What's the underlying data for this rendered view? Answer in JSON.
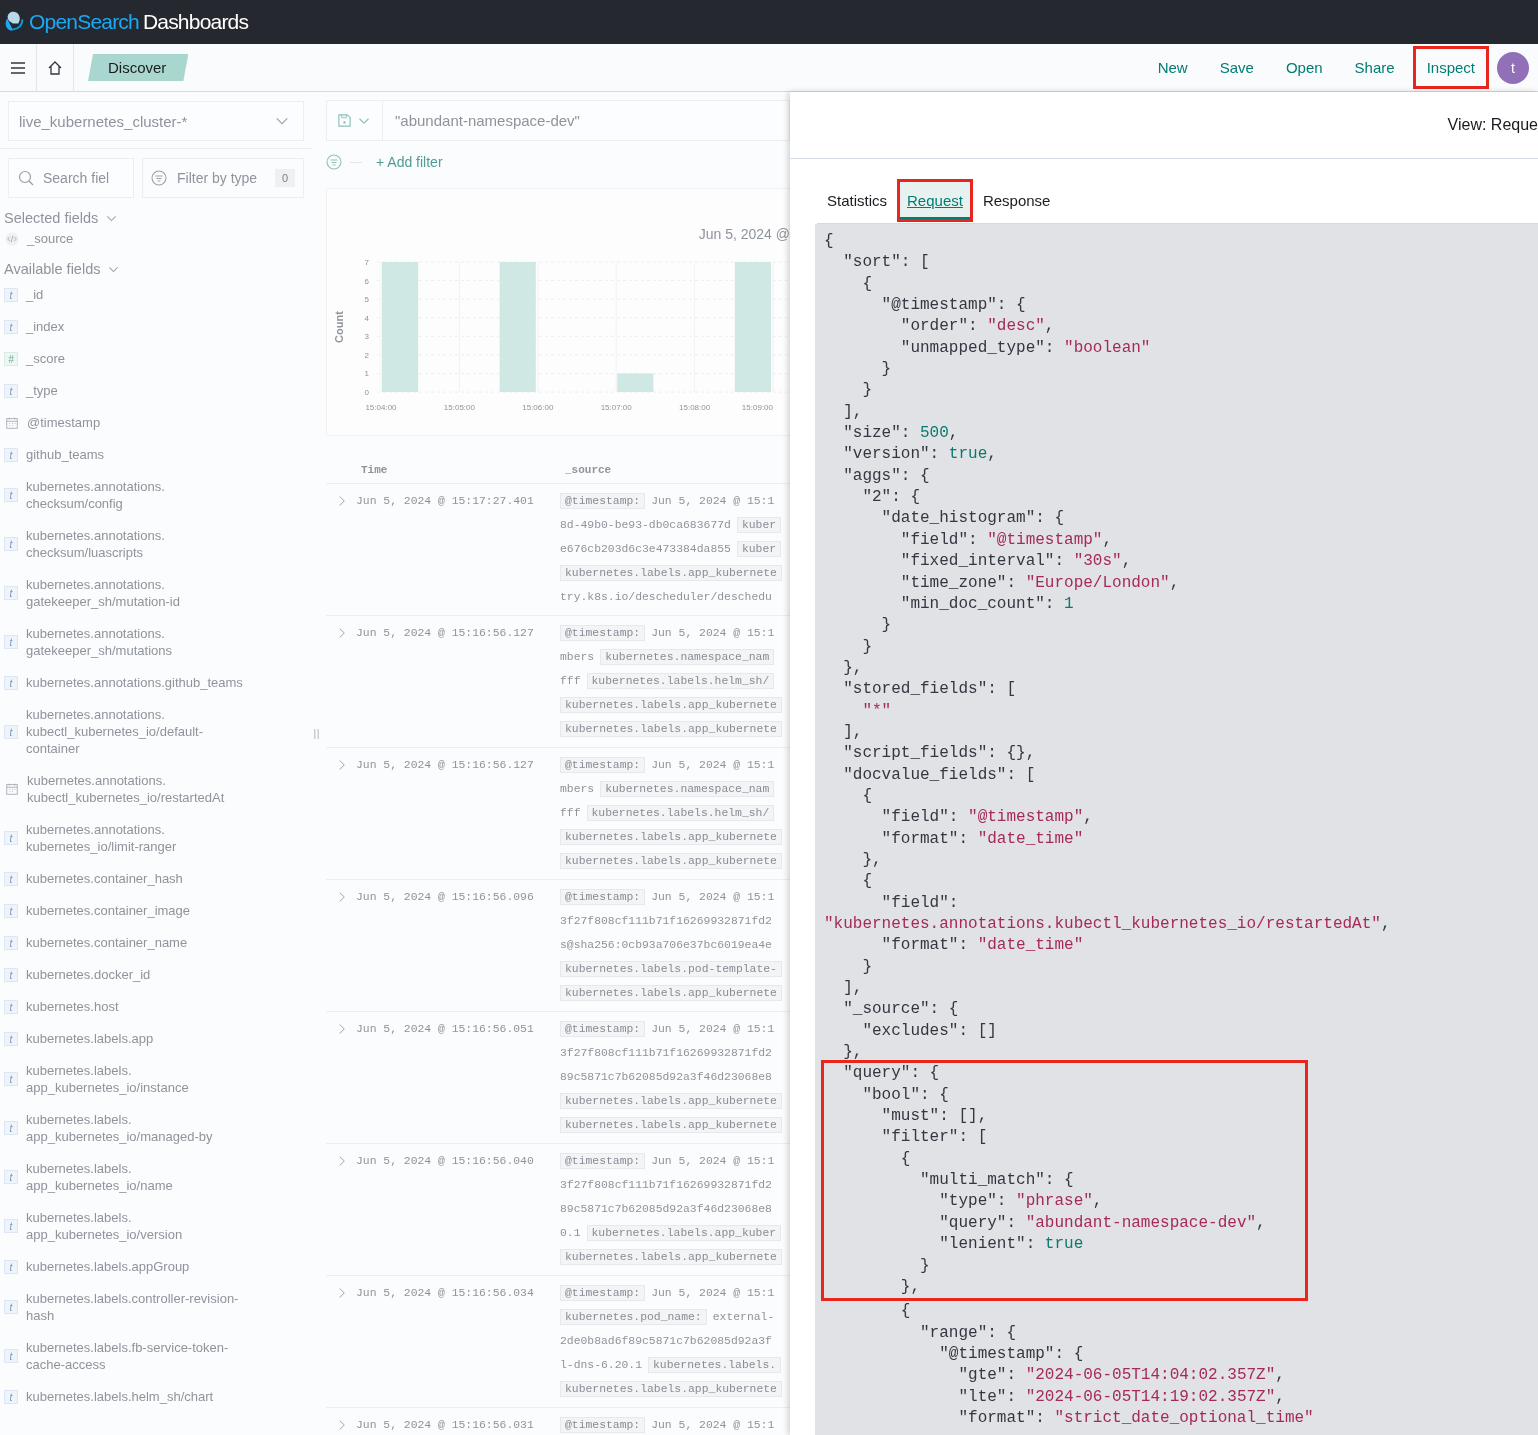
{
  "header": {
    "brand": "OpenSearch",
    "product": "Dashboards"
  },
  "nav": {
    "breadcrumb": "Discover",
    "links": [
      {
        "label": "New",
        "highlighted": false
      },
      {
        "label": "Save",
        "highlighted": false
      },
      {
        "label": "Open",
        "highlighted": false
      },
      {
        "label": "Share",
        "highlighted": false
      },
      {
        "label": "Inspect",
        "highlighted": true
      }
    ],
    "avatar": "t"
  },
  "sidebar": {
    "index_pattern": "live_kubernetes_cluster-*",
    "search": {
      "placeholder": "Search fiel"
    },
    "filter": {
      "label": "Filter by type",
      "count": "0"
    },
    "selected_title": "Selected fields",
    "selected_fields": [
      {
        "name": "_source",
        "kind": "source"
      }
    ],
    "available_title": "Available fields",
    "available_fields": [
      {
        "name": "_id",
        "kind": "text",
        "token": "t"
      },
      {
        "name": "_index",
        "kind": "text",
        "token": "t"
      },
      {
        "name": "_score",
        "kind": "number",
        "token": "#"
      },
      {
        "name": "_type",
        "kind": "text",
        "token": "t"
      },
      {
        "name": "@timestamp",
        "kind": "date"
      },
      {
        "name": "github_teams",
        "kind": "text",
        "token": "t"
      },
      {
        "name": "kubernetes.annotations.checksum/config",
        "kind": "text",
        "token": "t"
      },
      {
        "name": "kubernetes.annotations.checksum/luascripts",
        "kind": "text",
        "token": "t"
      },
      {
        "name": "kubernetes.annotations.gatekeeper_sh/mutation-id",
        "kind": "text",
        "token": "t"
      },
      {
        "name": "kubernetes.annotations.gatekeeper_sh/mutations",
        "kind": "text",
        "token": "t"
      },
      {
        "name": "kubernetes.annotations.github_teams",
        "kind": "text",
        "token": "t"
      },
      {
        "name": "kubernetes.annotations.kubectl_kubernetes_io/default-container",
        "kind": "text",
        "token": "t"
      },
      {
        "name": "kubernetes.annotations.kubectl_kubernetes_io/restartedAt",
        "kind": "date"
      },
      {
        "name": "kubernetes.annotations.kubernetes_io/limit-ranger",
        "kind": "text",
        "token": "t"
      },
      {
        "name": "kubernetes.container_hash",
        "kind": "text",
        "token": "t"
      },
      {
        "name": "kubernetes.container_image",
        "kind": "text",
        "token": "t"
      },
      {
        "name": "kubernetes.container_name",
        "kind": "text",
        "token": "t"
      },
      {
        "name": "kubernetes.docker_id",
        "kind": "text",
        "token": "t"
      },
      {
        "name": "kubernetes.host",
        "kind": "text",
        "token": "t"
      },
      {
        "name": "kubernetes.labels.app",
        "kind": "text",
        "token": "t"
      },
      {
        "name": "kubernetes.labels.app_kubernetes_io/instance",
        "kind": "text",
        "token": "t"
      },
      {
        "name": "kubernetes.labels.app_kubernetes_io/managed-by",
        "kind": "text",
        "token": "t"
      },
      {
        "name": "kubernetes.labels.app_kubernetes_io/name",
        "kind": "text",
        "token": "t"
      },
      {
        "name": "kubernetes.labels.app_kubernetes_io/version",
        "kind": "text",
        "token": "t"
      },
      {
        "name": "kubernetes.labels.appGroup",
        "kind": "text",
        "token": "t"
      },
      {
        "name": "kubernetes.labels.controller-revision-hash",
        "kind": "text",
        "token": "t"
      },
      {
        "name": "kubernetes.labels.fb-service-token-cache-access",
        "kind": "text",
        "token": "t"
      },
      {
        "name": "kubernetes.labels.helm_sh/chart",
        "kind": "text",
        "token": "t"
      }
    ]
  },
  "query": {
    "value": "\"abundant-namespace-dev\"",
    "add_filter": "+ Add filter"
  },
  "histogram": {
    "range_label": "Jun 5, 2024 @",
    "chart_data": {
      "type": "bar",
      "ylabel": "Count",
      "categories": [
        "15:04:00",
        null,
        "15:05:00",
        null,
        "15:06:00",
        null,
        "15:07:00",
        null,
        "15:08:00",
        null,
        "15:09:00"
      ],
      "values": [
        7,
        null,
        null,
        7,
        null,
        null,
        1,
        null,
        null,
        7,
        null
      ],
      "ylim": [
        0,
        7
      ],
      "yticks": [
        0,
        1,
        2,
        3,
        4,
        5,
        6,
        7
      ],
      "grid": true
    }
  },
  "table": {
    "columns": [
      "Time",
      "_source"
    ],
    "rows": [
      {
        "time": "Jun 5, 2024 @ 15:17:27.401",
        "source": [
          [
            {
              "kind": "field",
              "text": "@timestamp:"
            },
            {
              "kind": "value",
              "text": "Jun 5, 2024 @ 15:1"
            }
          ],
          [
            {
              "kind": "value",
              "text": "8d-49b0-be93-db0ca683677d"
            },
            {
              "kind": "field",
              "text": "kuber"
            }
          ],
          [
            {
              "kind": "value",
              "text": "e676cb203d6c3e473384da855"
            },
            {
              "kind": "field",
              "text": "kuber"
            }
          ],
          [
            {
              "kind": "field",
              "text": "kubernetes.labels.app_kubernete"
            }
          ],
          [
            {
              "kind": "value",
              "text": "try.k8s.io/descheduler/deschedu"
            }
          ]
        ]
      },
      {
        "time": "Jun 5, 2024 @ 15:16:56.127",
        "source": [
          [
            {
              "kind": "field",
              "text": "@timestamp:"
            },
            {
              "kind": "value",
              "text": "Jun 5, 2024 @ 15:1"
            }
          ],
          [
            {
              "kind": "value",
              "text": "mbers"
            },
            {
              "kind": "field",
              "text": "kubernetes.namespace_nam"
            }
          ],
          [
            {
              "kind": "value",
              "text": "fff"
            },
            {
              "kind": "field",
              "text": "kubernetes.labels.helm_sh/"
            }
          ],
          [
            {
              "kind": "field",
              "text": "kubernetes.labels.app_kubernete"
            }
          ],
          [
            {
              "kind": "field",
              "text": "kubernetes.labels.app_kubernete"
            }
          ]
        ]
      },
      {
        "time": "Jun 5, 2024 @ 15:16:56.127",
        "source": [
          [
            {
              "kind": "field",
              "text": "@timestamp:"
            },
            {
              "kind": "value",
              "text": "Jun 5, 2024 @ 15:1"
            }
          ],
          [
            {
              "kind": "value",
              "text": "mbers"
            },
            {
              "kind": "field",
              "text": "kubernetes.namespace_nam"
            }
          ],
          [
            {
              "kind": "value",
              "text": "fff"
            },
            {
              "kind": "field",
              "text": "kubernetes.labels.helm_sh/"
            }
          ],
          [
            {
              "kind": "field",
              "text": "kubernetes.labels.app_kubernete"
            }
          ],
          [
            {
              "kind": "field",
              "text": "kubernetes.labels.app_kubernete"
            }
          ]
        ]
      },
      {
        "time": "Jun 5, 2024 @ 15:16:56.096",
        "source": [
          [
            {
              "kind": "field",
              "text": "@timestamp:"
            },
            {
              "kind": "value",
              "text": "Jun 5, 2024 @ 15:1"
            }
          ],
          [
            {
              "kind": "value",
              "text": "3f27f808cf111b71f16269932871fd2"
            }
          ],
          [
            {
              "kind": "value",
              "text": "s@sha256:0cb93a706e37bc6019ea4e"
            }
          ],
          [
            {
              "kind": "field",
              "text": "kubernetes.labels.pod-template-"
            }
          ],
          [
            {
              "kind": "field",
              "text": "kubernetes.labels.app_kubernete"
            }
          ]
        ]
      },
      {
        "time": "Jun 5, 2024 @ 15:16:56.051",
        "source": [
          [
            {
              "kind": "field",
              "text": "@timestamp:"
            },
            {
              "kind": "value",
              "text": "Jun 5, 2024 @ 15:1"
            }
          ],
          [
            {
              "kind": "value",
              "text": "3f27f808cf111b71f16269932871fd2"
            }
          ],
          [
            {
              "kind": "value",
              "text": "89c5871c7b62085d92a3f46d23068e8"
            }
          ],
          [
            {
              "kind": "field",
              "text": "kubernetes.labels.app_kubernete"
            }
          ],
          [
            {
              "kind": "field",
              "text": "kubernetes.labels.app_kubernete"
            }
          ]
        ]
      },
      {
        "time": "Jun 5, 2024 @ 15:16:56.040",
        "source": [
          [
            {
              "kind": "field",
              "text": "@timestamp:"
            },
            {
              "kind": "value",
              "text": "Jun 5, 2024 @ 15:1"
            }
          ],
          [
            {
              "kind": "value",
              "text": "3f27f808cf111b71f16269932871fd2"
            }
          ],
          [
            {
              "kind": "value",
              "text": "89c5871c7b62085d92a3f46d23068e8"
            }
          ],
          [
            {
              "kind": "value",
              "text": "0.1"
            },
            {
              "kind": "field",
              "text": "kubernetes.labels.app_kuber"
            }
          ],
          [
            {
              "kind": "field",
              "text": "kubernetes.labels.app_kubernete"
            }
          ]
        ]
      },
      {
        "time": "Jun 5, 2024 @ 15:16:56.034",
        "source": [
          [
            {
              "kind": "field",
              "text": "@timestamp:"
            },
            {
              "kind": "value",
              "text": "Jun 5, 2024 @ 15:1"
            }
          ],
          [
            {
              "kind": "field",
              "text": "kubernetes.pod_name:"
            },
            {
              "kind": "value",
              "text": "external-"
            }
          ],
          [
            {
              "kind": "value",
              "text": "2de0b8ad6f89c5871c7b62085d92a3f"
            }
          ],
          [
            {
              "kind": "value",
              "text": "l-dns-6.20.1"
            },
            {
              "kind": "field",
              "text": "kubernetes.labels."
            }
          ],
          [
            {
              "kind": "field",
              "text": "kubernetes.labels.app_kubernete"
            }
          ]
        ]
      },
      {
        "time": "Jun 5, 2024 @ 15:16:56.031",
        "source": [
          [
            {
              "kind": "field",
              "text": "@timestamp:"
            },
            {
              "kind": "value",
              "text": "Jun 5, 2024 @ 15:1"
            }
          ]
        ]
      }
    ]
  },
  "inspector": {
    "view_label": "View: Reque",
    "tabs": [
      {
        "label": "Statistics",
        "selected": false,
        "highlighted": false
      },
      {
        "label": "Request",
        "selected": true,
        "highlighted": true
      },
      {
        "label": "Response",
        "selected": false,
        "highlighted": false
      }
    ],
    "code": [
      {
        "highlighted": false,
        "lines": [
          [
            {
              "kind": "plain",
              "text": "{"
            }
          ],
          [
            {
              "kind": "plain",
              "text": "  \"sort\": ["
            }
          ],
          [
            {
              "kind": "plain",
              "text": "    {"
            }
          ],
          [
            {
              "kind": "plain",
              "text": "      \"@timestamp\": {"
            }
          ],
          [
            {
              "kind": "plain",
              "text": "        \"order\": "
            },
            {
              "kind": "string",
              "text": "\"desc\""
            },
            {
              "kind": "plain",
              "text": ","
            }
          ],
          [
            {
              "kind": "plain",
              "text": "        \"unmapped_type\": "
            },
            {
              "kind": "string",
              "text": "\"boolean\""
            }
          ],
          [
            {
              "kind": "plain",
              "text": "      }"
            }
          ],
          [
            {
              "kind": "plain",
              "text": "    }"
            }
          ],
          [
            {
              "kind": "plain",
              "text": "  ],"
            }
          ],
          [
            {
              "kind": "plain",
              "text": "  \"size\": "
            },
            {
              "kind": "literal",
              "text": "500"
            },
            {
              "kind": "plain",
              "text": ","
            }
          ],
          [
            {
              "kind": "plain",
              "text": "  \"version\": "
            },
            {
              "kind": "literal",
              "text": "true"
            },
            {
              "kind": "plain",
              "text": ","
            }
          ],
          [
            {
              "kind": "plain",
              "text": "  \"aggs\": {"
            }
          ],
          [
            {
              "kind": "plain",
              "text": "    \"2\": {"
            }
          ],
          [
            {
              "kind": "plain",
              "text": "      \"date_histogram\": {"
            }
          ],
          [
            {
              "kind": "plain",
              "text": "        \"field\": "
            },
            {
              "kind": "string",
              "text": "\"@timestamp\""
            },
            {
              "kind": "plain",
              "text": ","
            }
          ],
          [
            {
              "kind": "plain",
              "text": "        \"fixed_interval\": "
            },
            {
              "kind": "string",
              "text": "\"30s\""
            },
            {
              "kind": "plain",
              "text": ","
            }
          ],
          [
            {
              "kind": "plain",
              "text": "        \"time_zone\": "
            },
            {
              "kind": "string",
              "text": "\"Europe/London\""
            },
            {
              "kind": "plain",
              "text": ","
            }
          ],
          [
            {
              "kind": "plain",
              "text": "        \"min_doc_count\": "
            },
            {
              "kind": "literal",
              "text": "1"
            }
          ],
          [
            {
              "kind": "plain",
              "text": "      }"
            }
          ],
          [
            {
              "kind": "plain",
              "text": "    }"
            }
          ],
          [
            {
              "kind": "plain",
              "text": "  },"
            }
          ],
          [
            {
              "kind": "plain",
              "text": "  \"stored_fields\": ["
            }
          ],
          [
            {
              "kind": "string",
              "text": "    \"*\""
            }
          ],
          [
            {
              "kind": "plain",
              "text": "  ],"
            }
          ],
          [
            {
              "kind": "plain",
              "text": "  \"script_fields\": {},"
            }
          ],
          [
            {
              "kind": "plain",
              "text": "  \"docvalue_fields\": ["
            }
          ],
          [
            {
              "kind": "plain",
              "text": "    {"
            }
          ],
          [
            {
              "kind": "plain",
              "text": "      \"field\": "
            },
            {
              "kind": "string",
              "text": "\"@timestamp\""
            },
            {
              "kind": "plain",
              "text": ","
            }
          ],
          [
            {
              "kind": "plain",
              "text": "      \"format\": "
            },
            {
              "kind": "string",
              "text": "\"date_time\""
            }
          ],
          [
            {
              "kind": "plain",
              "text": "    },"
            }
          ],
          [
            {
              "kind": "plain",
              "text": "    {"
            }
          ],
          [
            {
              "kind": "plain",
              "text": "      \"field\":"
            }
          ],
          [
            {
              "kind": "string",
              "text": "\"kubernetes.annotations.kubectl_kubernetes_io/restartedAt\""
            },
            {
              "kind": "plain",
              "text": ","
            }
          ],
          [
            {
              "kind": "plain",
              "text": "      \"format\": "
            },
            {
              "kind": "string",
              "text": "\"date_time\""
            }
          ],
          [
            {
              "kind": "plain",
              "text": "    }"
            }
          ],
          [
            {
              "kind": "plain",
              "text": "  ],"
            }
          ],
          [
            {
              "kind": "plain",
              "text": "  \"_source\": {"
            }
          ],
          [
            {
              "kind": "plain",
              "text": "    \"excludes\": []"
            }
          ],
          [
            {
              "kind": "plain",
              "text": "  },"
            }
          ]
        ]
      },
      {
        "highlighted": true,
        "lines": [
          [
            {
              "kind": "plain",
              "text": "  \"query\": {"
            }
          ],
          [
            {
              "kind": "plain",
              "text": "    \"bool\": {"
            }
          ],
          [
            {
              "kind": "plain",
              "text": "      \"must\": [],"
            }
          ],
          [
            {
              "kind": "plain",
              "text": "      \"filter\": ["
            }
          ],
          [
            {
              "kind": "plain",
              "text": "        {"
            }
          ],
          [
            {
              "kind": "plain",
              "text": "          \"multi_match\": {"
            }
          ],
          [
            {
              "kind": "plain",
              "text": "            \"type\": "
            },
            {
              "kind": "string",
              "text": "\"phrase\""
            },
            {
              "kind": "plain",
              "text": ","
            }
          ],
          [
            {
              "kind": "plain",
              "text": "            \"query\": "
            },
            {
              "kind": "string",
              "text": "\"abundant-namespace-dev\""
            },
            {
              "kind": "plain",
              "text": ","
            }
          ],
          [
            {
              "kind": "plain",
              "text": "            \"lenient\": "
            },
            {
              "kind": "literal",
              "text": "true"
            }
          ],
          [
            {
              "kind": "plain",
              "text": "          }"
            }
          ],
          [
            {
              "kind": "plain",
              "text": "        },"
            }
          ]
        ]
      },
      {
        "highlighted": false,
        "lines": [
          [
            {
              "kind": "plain",
              "text": "        {"
            }
          ],
          [
            {
              "kind": "plain",
              "text": "          \"range\": {"
            }
          ],
          [
            {
              "kind": "plain",
              "text": "            \"@timestamp\": {"
            }
          ],
          [
            {
              "kind": "plain",
              "text": "              \"gte\": "
            },
            {
              "kind": "string",
              "text": "\"2024-06-05T14:04:02.357Z\""
            },
            {
              "kind": "plain",
              "text": ","
            }
          ],
          [
            {
              "kind": "plain",
              "text": "              \"lte\": "
            },
            {
              "kind": "string",
              "text": "\"2024-06-05T14:19:02.357Z\""
            },
            {
              "kind": "plain",
              "text": ","
            }
          ],
          [
            {
              "kind": "plain",
              "text": "              \"format\": "
            },
            {
              "kind": "string",
              "text": "\"strict_date_optional_time\""
            }
          ]
        ]
      }
    ]
  }
}
